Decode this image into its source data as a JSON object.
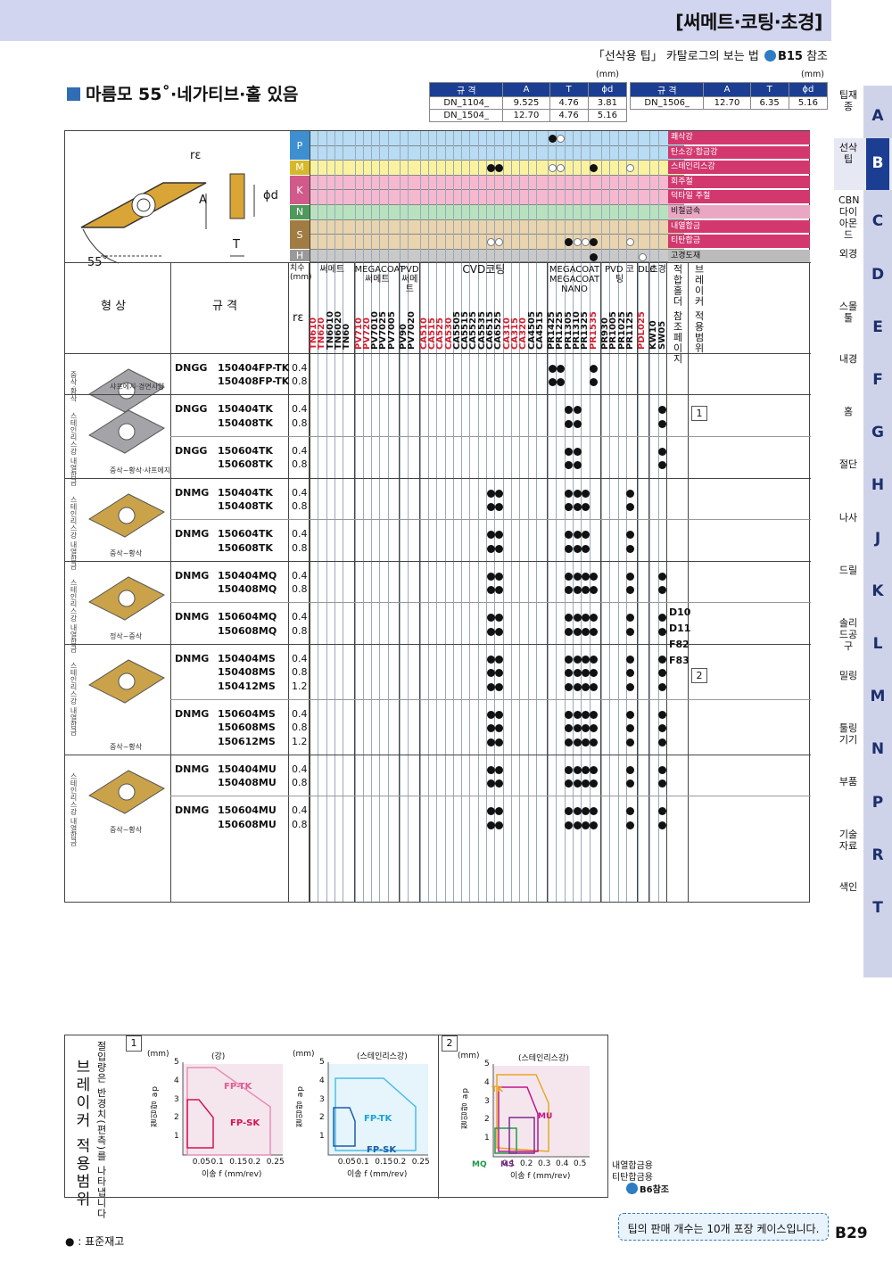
{
  "header": {
    "section": "[써메트·코팅·초경]",
    "catalog_ref": "「선삭용 팁」 카탈로그의 보는 법",
    "catalog_ref_page": "B15",
    "catalog_ref_suffix": "참조"
  },
  "title": "마름모 55˚·네가티브·홀 있음",
  "spec_tables": [
    {
      "unit": "(mm)",
      "headers": [
        "규 격",
        "A",
        "T",
        "ϕd"
      ],
      "rows": [
        [
          "DN_1104_",
          "9.525",
          "4.76",
          "3.81"
        ],
        [
          "DN_1504_",
          "12.70",
          "4.76",
          "5.16"
        ]
      ]
    },
    {
      "unit": "(mm)",
      "headers": [
        "규 격",
        "A",
        "T",
        "ϕd"
      ],
      "rows": [
        [
          "DN_1506_",
          "12.70",
          "6.35",
          "5.16"
        ]
      ]
    }
  ],
  "diagram": {
    "labels": [
      "rε",
      "A",
      "ϕd",
      "T",
      "55˚"
    ]
  },
  "material_groups": [
    {
      "code": "P",
      "color": "#b7dcf3",
      "items": [
        "쾌삭강",
        "탄소강·합금강"
      ]
    },
    {
      "code": "M",
      "color": "#fbf2a0",
      "items": [
        "스테인리스강"
      ]
    },
    {
      "code": "K",
      "color": "#f6b8cf",
      "items": [
        "회주철",
        "덕타일 주철"
      ]
    },
    {
      "code": "N",
      "color": "#b8e2be",
      "items": [
        "비철금속"
      ]
    },
    {
      "code": "S",
      "color": "#e9d4ae",
      "items": [
        "내열합금",
        "티탄합금"
      ]
    },
    {
      "code": "H",
      "color": "#c9c9c9",
      "items": [
        "고경도재"
      ]
    }
  ],
  "column_groups": [
    "치수(mm)",
    "써메트",
    "MEGACOAT 써메트",
    "PVD 써메트",
    "CVD코팅",
    "MEGACOAT MEGACOAT NANO",
    "PVD 코팅",
    "DLC",
    "초경",
    "적합홀더 참조페이지",
    "브레이커 적용범위"
  ],
  "head_labels": {
    "shape": "형 상",
    "spec": "규 격",
    "re": "rε"
  },
  "grades": [
    {
      "n": "TN610",
      "c": "r"
    },
    {
      "n": "TN620",
      "c": "r"
    },
    {
      "n": "TN6010",
      "c": "k"
    },
    {
      "n": "TN6020",
      "c": "k"
    },
    {
      "n": "TN60",
      "c": "k"
    },
    {
      "n": "PV710",
      "c": "r"
    },
    {
      "n": "PV720",
      "c": "r"
    },
    {
      "n": "PV7010",
      "c": "k"
    },
    {
      "n": "PV7025",
      "c": "k"
    },
    {
      "n": "PV7005",
      "c": "k"
    },
    {
      "n": "PV90",
      "c": "k"
    },
    {
      "n": "PV7020",
      "c": "k"
    },
    {
      "n": "CA510",
      "c": "r"
    },
    {
      "n": "CA515",
      "c": "r"
    },
    {
      "n": "CA525",
      "c": "r"
    },
    {
      "n": "CA530",
      "c": "r"
    },
    {
      "n": "CA5505",
      "c": "k"
    },
    {
      "n": "CA5515",
      "c": "k"
    },
    {
      "n": "CA5525",
      "c": "k"
    },
    {
      "n": "CA5535",
      "c": "k"
    },
    {
      "n": "CA6515",
      "c": "k"
    },
    {
      "n": "CA6525",
      "c": "k"
    },
    {
      "n": "CA310",
      "c": "r"
    },
    {
      "n": "CA315",
      "c": "r"
    },
    {
      "n": "CA320",
      "c": "r"
    },
    {
      "n": "CA4505",
      "c": "k"
    },
    {
      "n": "CA4515",
      "c": "k"
    },
    {
      "n": "PR1425",
      "c": "k"
    },
    {
      "n": "PR1225",
      "c": "k"
    },
    {
      "n": "PR1305",
      "c": "k"
    },
    {
      "n": "PR1310",
      "c": "k"
    },
    {
      "n": "PR1325",
      "c": "k"
    },
    {
      "n": "PR1535",
      "c": "r"
    },
    {
      "n": "PR930",
      "c": "k"
    },
    {
      "n": "PR1005",
      "c": "k"
    },
    {
      "n": "PR1025",
      "c": "k"
    },
    {
      "n": "PR1125",
      "c": "k"
    },
    {
      "n": "PDL025",
      "c": "r"
    },
    {
      "n": "KW10",
      "c": "k"
    },
    {
      "n": "SW05",
      "c": "k"
    }
  ],
  "product_groups": [
    {
      "side": "중삭·황삭",
      "caption": "샤프에지·경면사양",
      "rows": [
        {
          "type": "DNGG",
          "codes": [
            "150404FP-TK",
            "150408FP-TK"
          ],
          "re": [
            "0.4",
            "0.8"
          ],
          "grades": [
            27,
            28,
            32
          ]
        }
      ]
    },
    {
      "side": "스테인리스강 내열합금",
      "caption": "중삭~황삭·샤프에지",
      "rows": [
        {
          "type": "DNGG",
          "codes": [
            "150404TK",
            "150408TK"
          ],
          "re": [
            "0.4",
            "0.8"
          ],
          "grades": [
            29,
            30,
            39
          ]
        },
        {
          "type": "DNGG",
          "codes": [
            "150604TK",
            "150608TK"
          ],
          "re": [
            "0.4",
            "0.8"
          ],
          "grades": [
            29,
            30,
            39
          ]
        }
      ]
    },
    {
      "side": "스테인리스강 내열합금",
      "caption": "중삭~황삭",
      "rows": [
        {
          "type": "DNMG",
          "codes": [
            "150404TK",
            "150408TK"
          ],
          "re": [
            "0.4",
            "0.8"
          ],
          "grades": [
            20,
            21,
            29,
            30,
            31,
            36
          ]
        },
        {
          "type": "DNMG",
          "codes": [
            "150604TK",
            "150608TK"
          ],
          "re": [
            "0.4",
            "0.8"
          ],
          "grades": [
            20,
            21,
            29,
            30,
            31,
            36
          ]
        }
      ]
    },
    {
      "side": "스테인리스강 내열합금",
      "caption": "정삭~중삭",
      "rows": [
        {
          "type": "DNMG",
          "codes": [
            "150404MQ",
            "150408MQ"
          ],
          "re": [
            "0.4",
            "0.8"
          ],
          "grades": [
            20,
            21,
            29,
            30,
            31,
            32,
            36,
            39
          ]
        },
        {
          "type": "DNMG",
          "codes": [
            "150604MQ",
            "150608MQ"
          ],
          "re": [
            "0.4",
            "0.8"
          ],
          "grades": [
            20,
            21,
            29,
            30,
            31,
            32,
            36,
            39
          ]
        }
      ]
    },
    {
      "side": "스테인리스강 내열합금",
      "caption": "중삭~황삭",
      "rows": [
        {
          "type": "DNMG",
          "codes": [
            "150404MS",
            "150408MS",
            "150412MS"
          ],
          "re": [
            "0.4",
            "0.8",
            "1.2"
          ],
          "grades": [
            20,
            21,
            29,
            30,
            31,
            32,
            36,
            39
          ]
        },
        {
          "type": "DNMG",
          "codes": [
            "150604MS",
            "150608MS",
            "150612MS"
          ],
          "re": [
            "0.4",
            "0.8",
            "1.2"
          ],
          "grades": [
            20,
            21,
            29,
            30,
            31,
            32,
            36,
            39
          ]
        }
      ]
    },
    {
      "side": "스테인리스강 내열합금",
      "caption": "중삭~황삭",
      "rows": [
        {
          "type": "DNMG",
          "codes": [
            "150404MU",
            "150408MU"
          ],
          "re": [
            "0.4",
            "0.8"
          ],
          "grades": [
            20,
            21,
            29,
            30,
            31,
            32,
            36,
            39
          ]
        },
        {
          "type": "DNMG",
          "codes": [
            "150604MU",
            "150608MU"
          ],
          "re": [
            "0.4",
            "0.8"
          ],
          "grades": [
            20,
            21,
            29,
            30,
            31,
            32,
            36,
            39
          ]
        }
      ]
    }
  ],
  "holder_pages": [
    "D10",
    "D11",
    "F82",
    "F83"
  ],
  "breaker_refs": [
    "1",
    "2"
  ],
  "bottom": {
    "label": "브레이커 적용범위",
    "note": "절입량은 반경치(편측)를 나타냅니다",
    "chart1": {
      "tag": "1",
      "ylabel": "절입량 ap",
      "unit": "(mm)",
      "xlabel": "이송 f (mm/rev)"
    },
    "chart_a": {
      "title": "(강)",
      "xticks": [
        "0.05",
        "0.1",
        "0.15",
        "0.2",
        "0.25"
      ],
      "yticks": [
        "1",
        "2",
        "3",
        "4",
        "5"
      ],
      "series": [
        "FP-TK",
        "FP-SK"
      ]
    },
    "chart_b": {
      "title": "(스테인리스강)",
      "xticks": [
        "0.05",
        "0.1",
        "0.15",
        "0.2",
        "0.25"
      ],
      "yticks": [
        "1",
        "2",
        "3",
        "4",
        "5"
      ],
      "series": [
        "FP-TK",
        "FP-SK"
      ]
    },
    "chart2": {
      "tag": "2",
      "title": "(스테인리스강)",
      "unit": "(mm)",
      "ylabel": "절입량 ap",
      "xlabel": "이송 f (mm/rev)",
      "xticks": [
        "0.1",
        "0.2",
        "0.3",
        "0.4",
        "0.5"
      ],
      "yticks": [
        "1",
        "2",
        "3",
        "4",
        "5"
      ],
      "series": [
        "TK",
        "MU",
        "MQ",
        "MS"
      ]
    }
  },
  "ref_note": {
    "line1": "내열합금용",
    "line2": "티탄합금용",
    "ref": "B6참조"
  },
  "footer": {
    "legend": "● : 표준재고",
    "pack_note": "팁의 판매 개수는 10개 포장 케이스입니다.",
    "page": "B29"
  },
  "tabs": [
    {
      "letter": "A",
      "label": "팁재종"
    },
    {
      "letter": "B",
      "label": "선삭팁",
      "active": true
    },
    {
      "letter": "C",
      "label": "CBN다이아몬드"
    },
    {
      "letter": "D",
      "label": "외경"
    },
    {
      "letter": "E",
      "label": "스몰툴"
    },
    {
      "letter": "F",
      "label": "내경"
    },
    {
      "letter": "G",
      "label": "홈"
    },
    {
      "letter": "H",
      "label": "절단"
    },
    {
      "letter": "J",
      "label": "나사"
    },
    {
      "letter": "K",
      "label": "드릴"
    },
    {
      "letter": "L",
      "label": "솔리드공구"
    },
    {
      "letter": "M",
      "label": "밀링"
    },
    {
      "letter": "N",
      "label": "툴링기기"
    },
    {
      "letter": "P",
      "label": "부품"
    },
    {
      "letter": "R",
      "label": "기술자료"
    },
    {
      "letter": "T",
      "label": "색인"
    }
  ]
}
